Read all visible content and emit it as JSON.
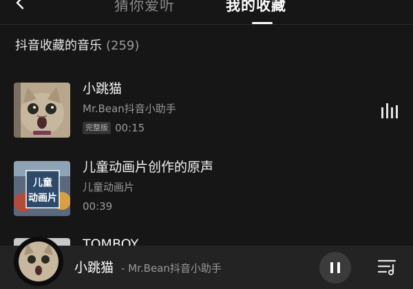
{
  "tabs": {
    "guess": "猜你爱听",
    "favorites": "我的收藏"
  },
  "section": {
    "title": "抖音收藏的音乐",
    "count": "(259)"
  },
  "songs": [
    {
      "title": "小跳猫",
      "artist": "Mr.Bean抖音小助手",
      "badge": "完整版",
      "duration": "00:15",
      "playing": true
    },
    {
      "title": "儿童动画片创作的原声",
      "artist": "儿童动画片",
      "duration": "00:39",
      "cover_text": "儿童\n动画片"
    },
    {
      "title": "TOMBOY"
    }
  ],
  "player": {
    "title": "小跳猫",
    "artist": "- Mr.Bean抖音小助手"
  },
  "icons": {
    "back": "chevron-left-icon",
    "playing": "equalizer-bars-icon",
    "pause": "pause-icon",
    "playlist": "playlist-icon"
  }
}
